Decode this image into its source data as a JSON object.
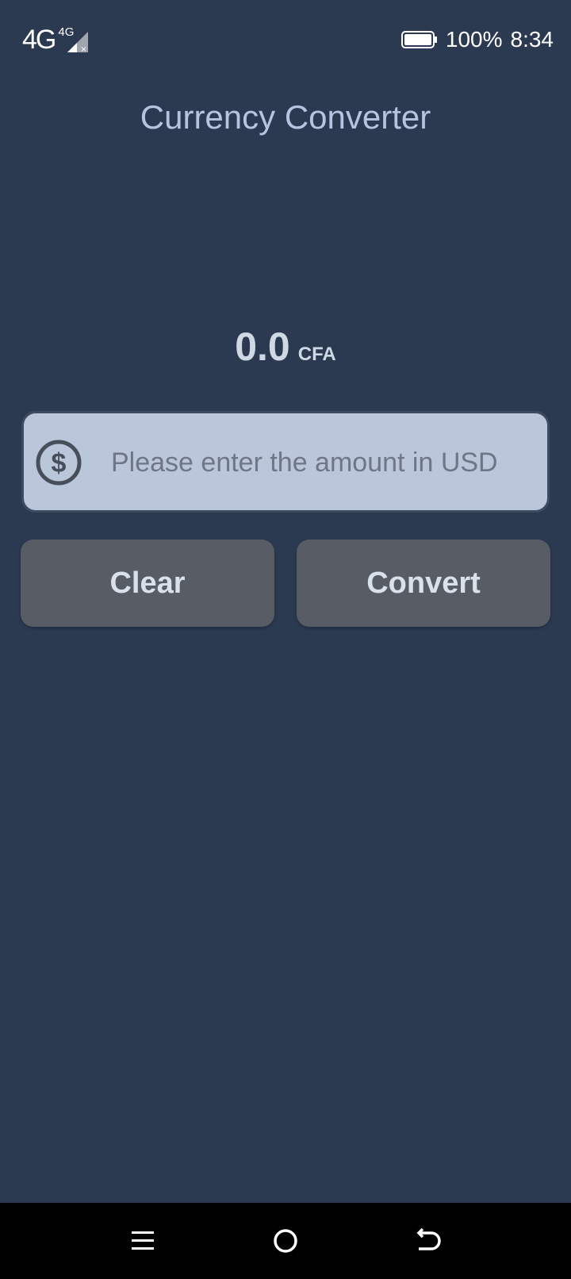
{
  "status_bar": {
    "network": "4G",
    "network_secondary": "4G",
    "battery_percent": "100%",
    "time": "8:34"
  },
  "app": {
    "title": "Currency Converter"
  },
  "result": {
    "value": "0.0",
    "unit": "CFA"
  },
  "amount_input": {
    "value": "",
    "placeholder": "Please enter the amount in USD",
    "icon": "dollar-circle-icon"
  },
  "buttons": {
    "clear_label": "Clear",
    "convert_label": "Convert"
  },
  "nav": {
    "menu_icon": "menu-icon",
    "home_icon": "home-icon",
    "back_icon": "back-icon"
  },
  "colors": {
    "background": "#2c3a51",
    "title": "#b5c5e1",
    "input_bg": "#bac6da",
    "button_bg": "#585d65",
    "button_text": "#d9e2ea"
  }
}
